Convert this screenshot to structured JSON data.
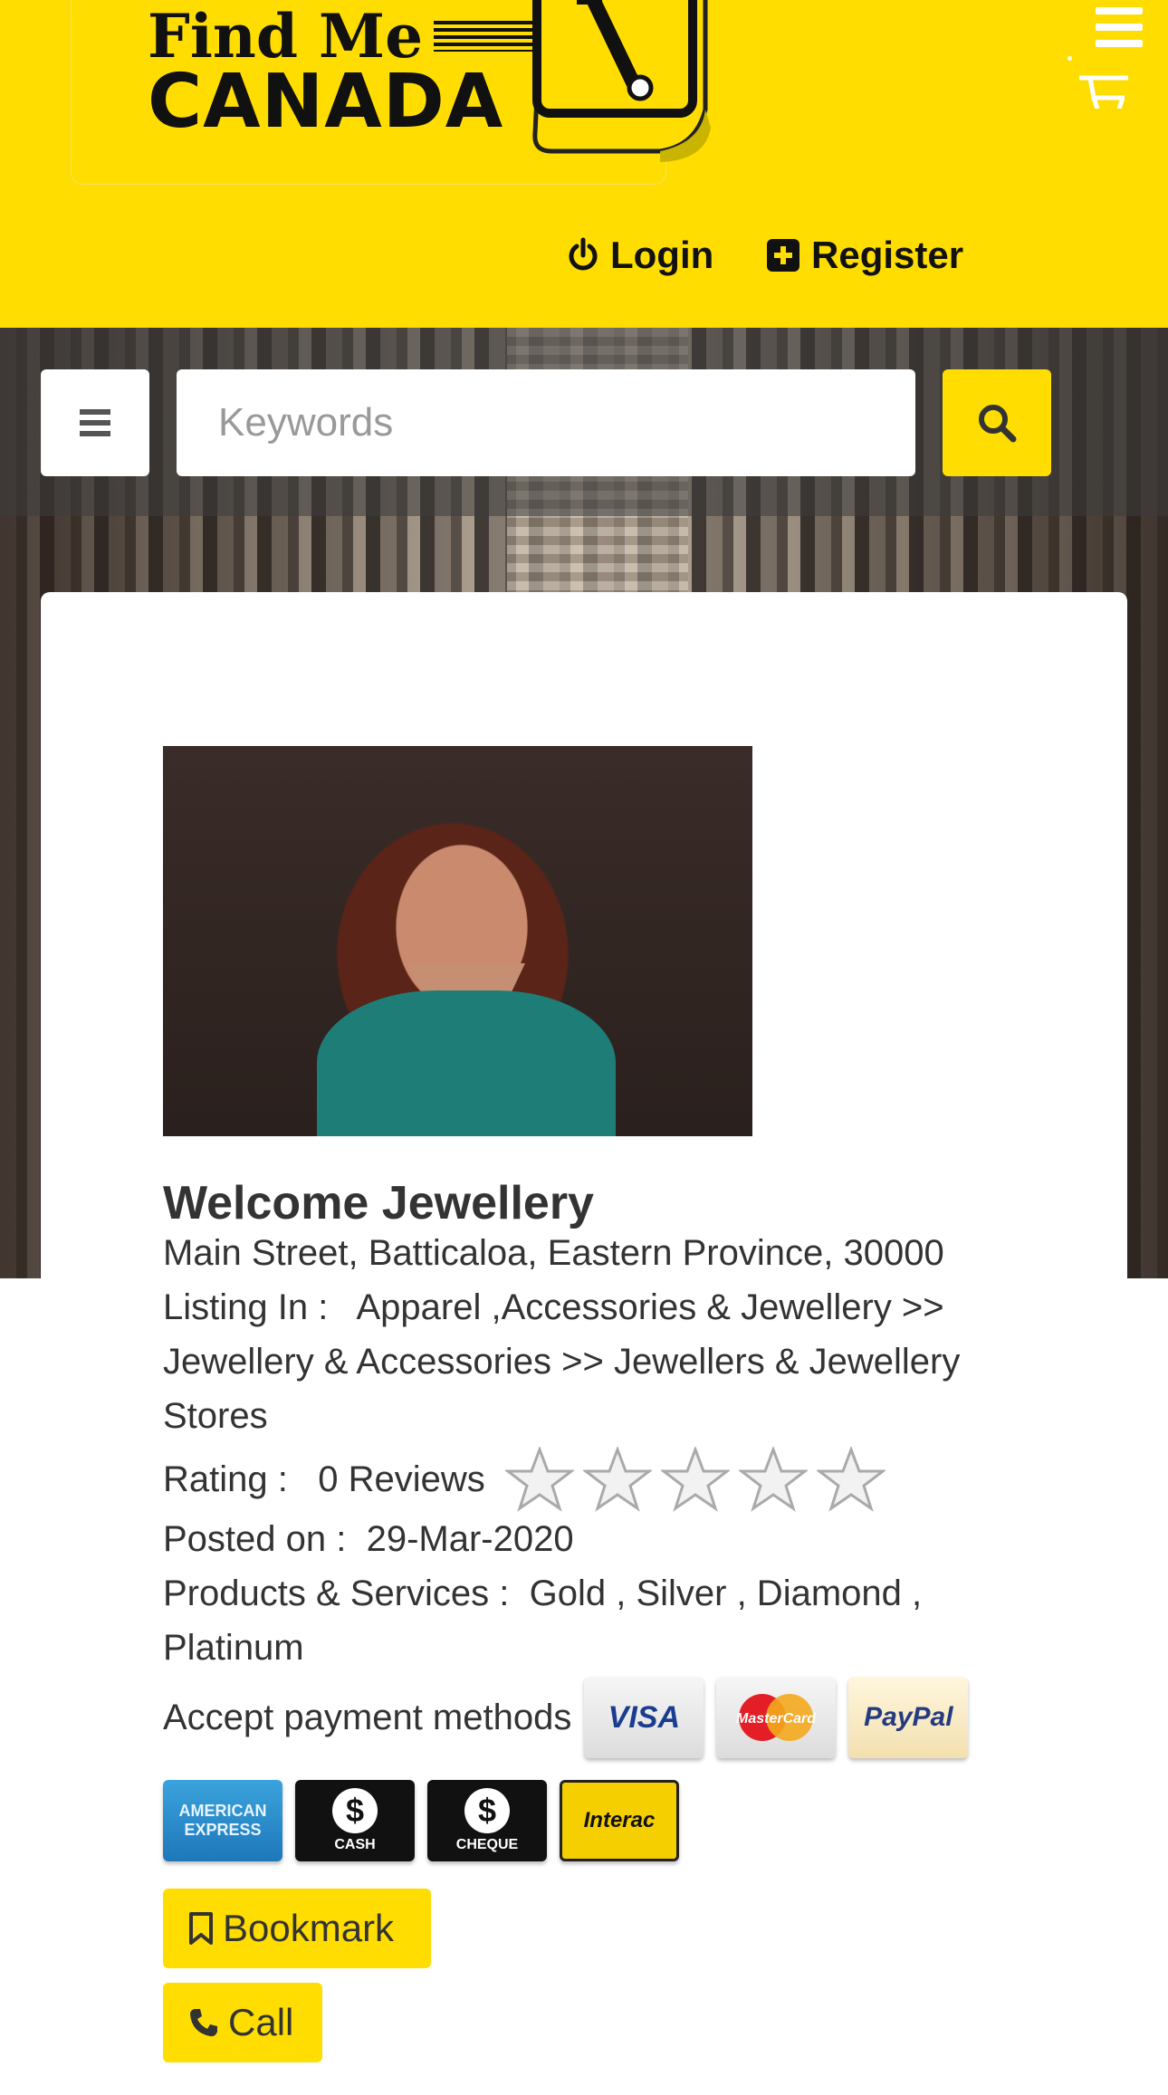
{
  "header": {
    "logo": {
      "line1": "Find Me",
      "line2": "CANADA"
    },
    "login_label": "Login",
    "register_label": "Register",
    "colors": {
      "brand_yellow": "#ffdd00"
    }
  },
  "search": {
    "placeholder": "Keywords",
    "value": ""
  },
  "listing": {
    "title": "Welcome Jewellery",
    "address": "Main Street, Batticaloa, Eastern Province, 30000",
    "listing_in_label": "Listing In :",
    "listing_in_value": "Apparel ,Accessories & Jewellery >> Jewellery & Accessories >> Jewellers & Jewellery Stores",
    "rating_label": "Rating :",
    "reviews": "0 Reviews",
    "rating_value": 0,
    "rating_max": 5,
    "posted_label": "Posted on :",
    "posted_value": "29-Mar-2020",
    "products_label": "Products & Services :",
    "products_value": "Gold , Silver , Diamond , Platinum",
    "payment_label": "Accept payment methods",
    "payment_methods": {
      "visa": "VISA",
      "mastercard": "MasterCard",
      "paypal": "PayPal",
      "amex_line1": "AMERICAN",
      "amex_line2": "EXPRESS",
      "cash": "CASH",
      "cheque": "CHEQUE",
      "interac": "Interac"
    },
    "bookmark_label": "Bookmark",
    "call_label": "Call"
  }
}
